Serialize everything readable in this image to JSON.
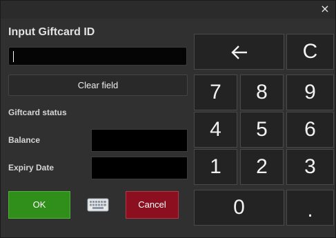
{
  "window": {
    "close_label": "×"
  },
  "title": "Input Giftcard ID",
  "giftcard_input": {
    "value": ""
  },
  "clear_button": "Clear field",
  "status_label": "Giftcard status",
  "balance": {
    "label": "Balance",
    "value": ""
  },
  "expiry": {
    "label": "Expiry Date",
    "value": ""
  },
  "ok_button": "OK",
  "cancel_button": "Cancel",
  "keyboard_icon": "keyboard-icon",
  "keypad": {
    "backspace": "←",
    "clear": "C",
    "keys": [
      "7",
      "8",
      "9",
      "4",
      "5",
      "6",
      "1",
      "2",
      "3"
    ],
    "zero": "0",
    "dot": "."
  },
  "colors": {
    "ok": "#2f8f1a",
    "cancel": "#8b0f1f",
    "background": "#303030"
  }
}
